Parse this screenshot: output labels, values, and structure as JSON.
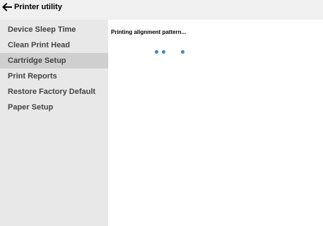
{
  "app": {
    "title": "Printer utility",
    "back_icon": "back-arrow-icon"
  },
  "sidebar": {
    "items": [
      {
        "label": "Device Sleep Time"
      },
      {
        "label": "Clean Print Head"
      },
      {
        "label": "Cartridge Setup",
        "active": true
      },
      {
        "label": "Print Reports"
      },
      {
        "label": "Restore Factory Default"
      },
      {
        "label": "Paper Setup"
      }
    ]
  },
  "main": {
    "status_text": "Printing alignment pattern...",
    "progress_indicator": "loading-dots-icon"
  },
  "colors": {
    "sidebar_bg": "#e8e8e8",
    "sidebar_active_bg": "#cfcfcf",
    "accent_dots": "#3b86c6"
  }
}
